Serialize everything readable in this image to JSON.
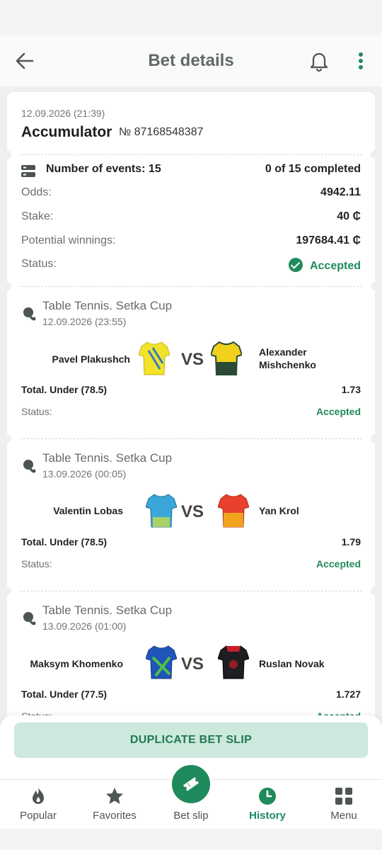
{
  "header": {
    "title": "Bet details"
  },
  "bet": {
    "datetime": "12.09.2026 (21:39)",
    "type": "Accumulator",
    "number": "№ 87168548387"
  },
  "summary": {
    "events_label": "Number of events: 15",
    "completed": "0 of 15 completed",
    "odds_label": "Odds:",
    "odds_value": "4942.11",
    "stake_label": "Stake:",
    "stake_value": "40 ₵",
    "winnings_label": "Potential winnings:",
    "winnings_value": "197684.41 ₵",
    "status_label": "Status:",
    "status_value": "Accepted"
  },
  "events": [
    {
      "league": "Table Tennis. Setka Cup",
      "date": "12.09.2026 (23:55)",
      "player1": "Pavel Plakushch",
      "player2_line1": "Alexander",
      "player2_line2": "Mishchenko",
      "vs": "VS",
      "market": "Total. Under (78.5)",
      "odd": "1.73",
      "status_label": "Status:",
      "status": "Accepted",
      "jersey1": {
        "primary": "#f2e22a",
        "secondary": "#2f7fbf"
      },
      "jersey2": {
        "primary": "#f0d21c",
        "secondary": "#2b4a36"
      }
    },
    {
      "league": "Table Tennis. Setka Cup",
      "date": "13.09.2026 (00:05)",
      "player1": "Valentin Lobas",
      "player2": "Yan Krol",
      "vs": "VS",
      "market": "Total. Under (78.5)",
      "odd": "1.79",
      "status_label": "Status:",
      "status": "Accepted",
      "jersey1": {
        "primary": "#39a7d8",
        "secondary": "#d8e23a"
      },
      "jersey2": {
        "primary": "#e8412c",
        "secondary": "#f2b51c"
      }
    },
    {
      "league": "Table Tennis. Setka Cup",
      "date": "13.09.2026 (01:00)",
      "player1": "Maksym Khomenko",
      "player2": "Ruslan Novak",
      "vs": "VS",
      "market": "Total. Under (77.5)",
      "odd": "1.727",
      "status_label": "Status:",
      "status": "Accepted",
      "jersey1": {
        "primary": "#1f55b8",
        "secondary": "#4fc04a"
      },
      "jersey2": {
        "primary": "#1d1d22",
        "secondary": "#c8202a"
      }
    }
  ],
  "actions": {
    "duplicate": "DUPLICATE BET SLIP"
  },
  "tabs": [
    {
      "label": "Popular",
      "icon": "flame-icon"
    },
    {
      "label": "Favorites",
      "icon": "star-icon"
    },
    {
      "label": "Bet slip",
      "icon": "ticket-icon"
    },
    {
      "label": "History",
      "icon": "clock-icon"
    },
    {
      "label": "Menu",
      "icon": "grid-icon"
    }
  ],
  "colors": {
    "accent": "#1f8a5b",
    "button_bg": "#cde8dc"
  }
}
